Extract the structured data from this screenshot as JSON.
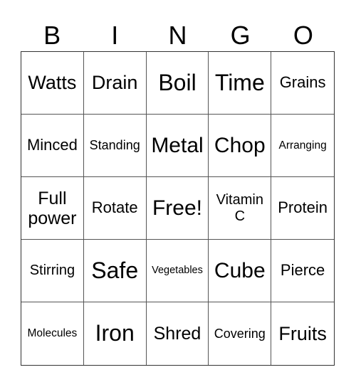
{
  "header": [
    "B",
    "I",
    "N",
    "G",
    "O"
  ],
  "cells": [
    "Watts",
    "Drain",
    "Boil",
    "Time",
    "Grains",
    "Minced",
    "Standing",
    "Metal",
    "Chop",
    "Arranging",
    "Full power",
    "Rotate",
    "Free!",
    "Vitamin C",
    "Protein",
    "Stirring",
    "Safe",
    "Vegetables",
    "Cube",
    "Pierce",
    "Molecules",
    "Iron",
    "Shred",
    "Covering",
    "Fruits"
  ]
}
